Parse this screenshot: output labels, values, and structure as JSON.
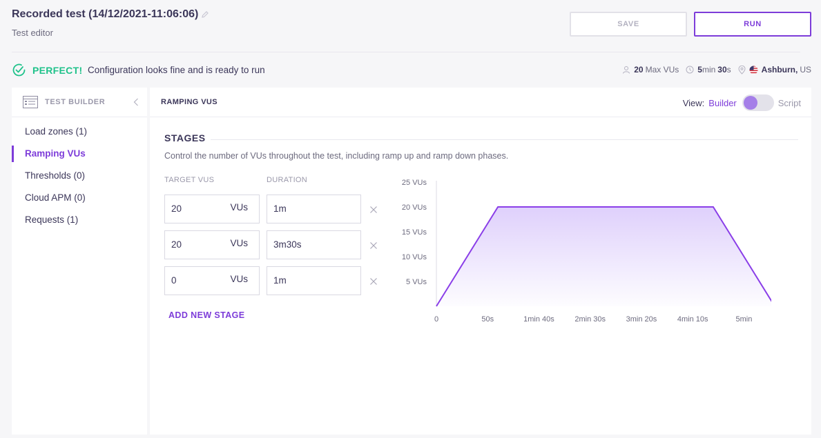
{
  "header": {
    "title": "Recorded test (14/12/2021-11:06:06)",
    "subtitle": "Test editor",
    "save_label": "SAVE",
    "run_label": "RUN"
  },
  "status": {
    "badge": "PERFECT!",
    "message": "Configuration looks fine and is ready to run",
    "max_vus_value": "20",
    "max_vus_label": "Max VUs",
    "duration_min": "5",
    "duration_min_unit": "min",
    "duration_sec": "30",
    "duration_sec_unit": "s",
    "location_city": "Ashburn,",
    "location_country": "US"
  },
  "sidebar": {
    "title": "TEST BUILDER",
    "items": [
      {
        "label": "Load zones (1)"
      },
      {
        "label": "Ramping VUs"
      },
      {
        "label": "Thresholds (0)"
      },
      {
        "label": "Cloud APM (0)"
      },
      {
        "label": "Requests (1)"
      }
    ]
  },
  "main": {
    "title": "RAMPING VUS",
    "view_label": "View:",
    "view_builder": "Builder",
    "view_script": "Script",
    "stages_heading": "STAGES",
    "stages_desc": "Control the number of VUs throughout the test, including ramp up and ramp down phases.",
    "col_target": "TARGET VUS",
    "col_duration": "DURATION",
    "unit": "VUs",
    "stages": [
      {
        "target": "20",
        "duration": "1m"
      },
      {
        "target": "20",
        "duration": "3m30s"
      },
      {
        "target": "0",
        "duration": "1m"
      }
    ],
    "add_stage": "ADD NEW STAGE"
  },
  "chart_data": {
    "type": "area",
    "x_seconds": [
      0,
      60,
      270,
      330
    ],
    "y": [
      0,
      20,
      20,
      0
    ],
    "ylim": [
      0,
      25
    ],
    "xlim": [
      0,
      330
    ],
    "yticks": [
      {
        "v": 5,
        "label": "5 VUs"
      },
      {
        "v": 10,
        "label": "10 VUs"
      },
      {
        "v": 15,
        "label": "15 VUs"
      },
      {
        "v": 20,
        "label": "20 VUs"
      },
      {
        "v": 25,
        "label": "25 VUs"
      }
    ],
    "xticks": [
      {
        "v": 0,
        "label": "0"
      },
      {
        "v": 50,
        "label": "50s"
      },
      {
        "v": 100,
        "label": "1min 40s"
      },
      {
        "v": 150,
        "label": "2min 30s"
      },
      {
        "v": 200,
        "label": "3min 20s"
      },
      {
        "v": 250,
        "label": "4min 10s"
      },
      {
        "v": 300,
        "label": "5min"
      }
    ],
    "color": "#8a3ee8"
  },
  "colors": {
    "accent": "#7d3cd9",
    "success": "#1fc28a"
  }
}
